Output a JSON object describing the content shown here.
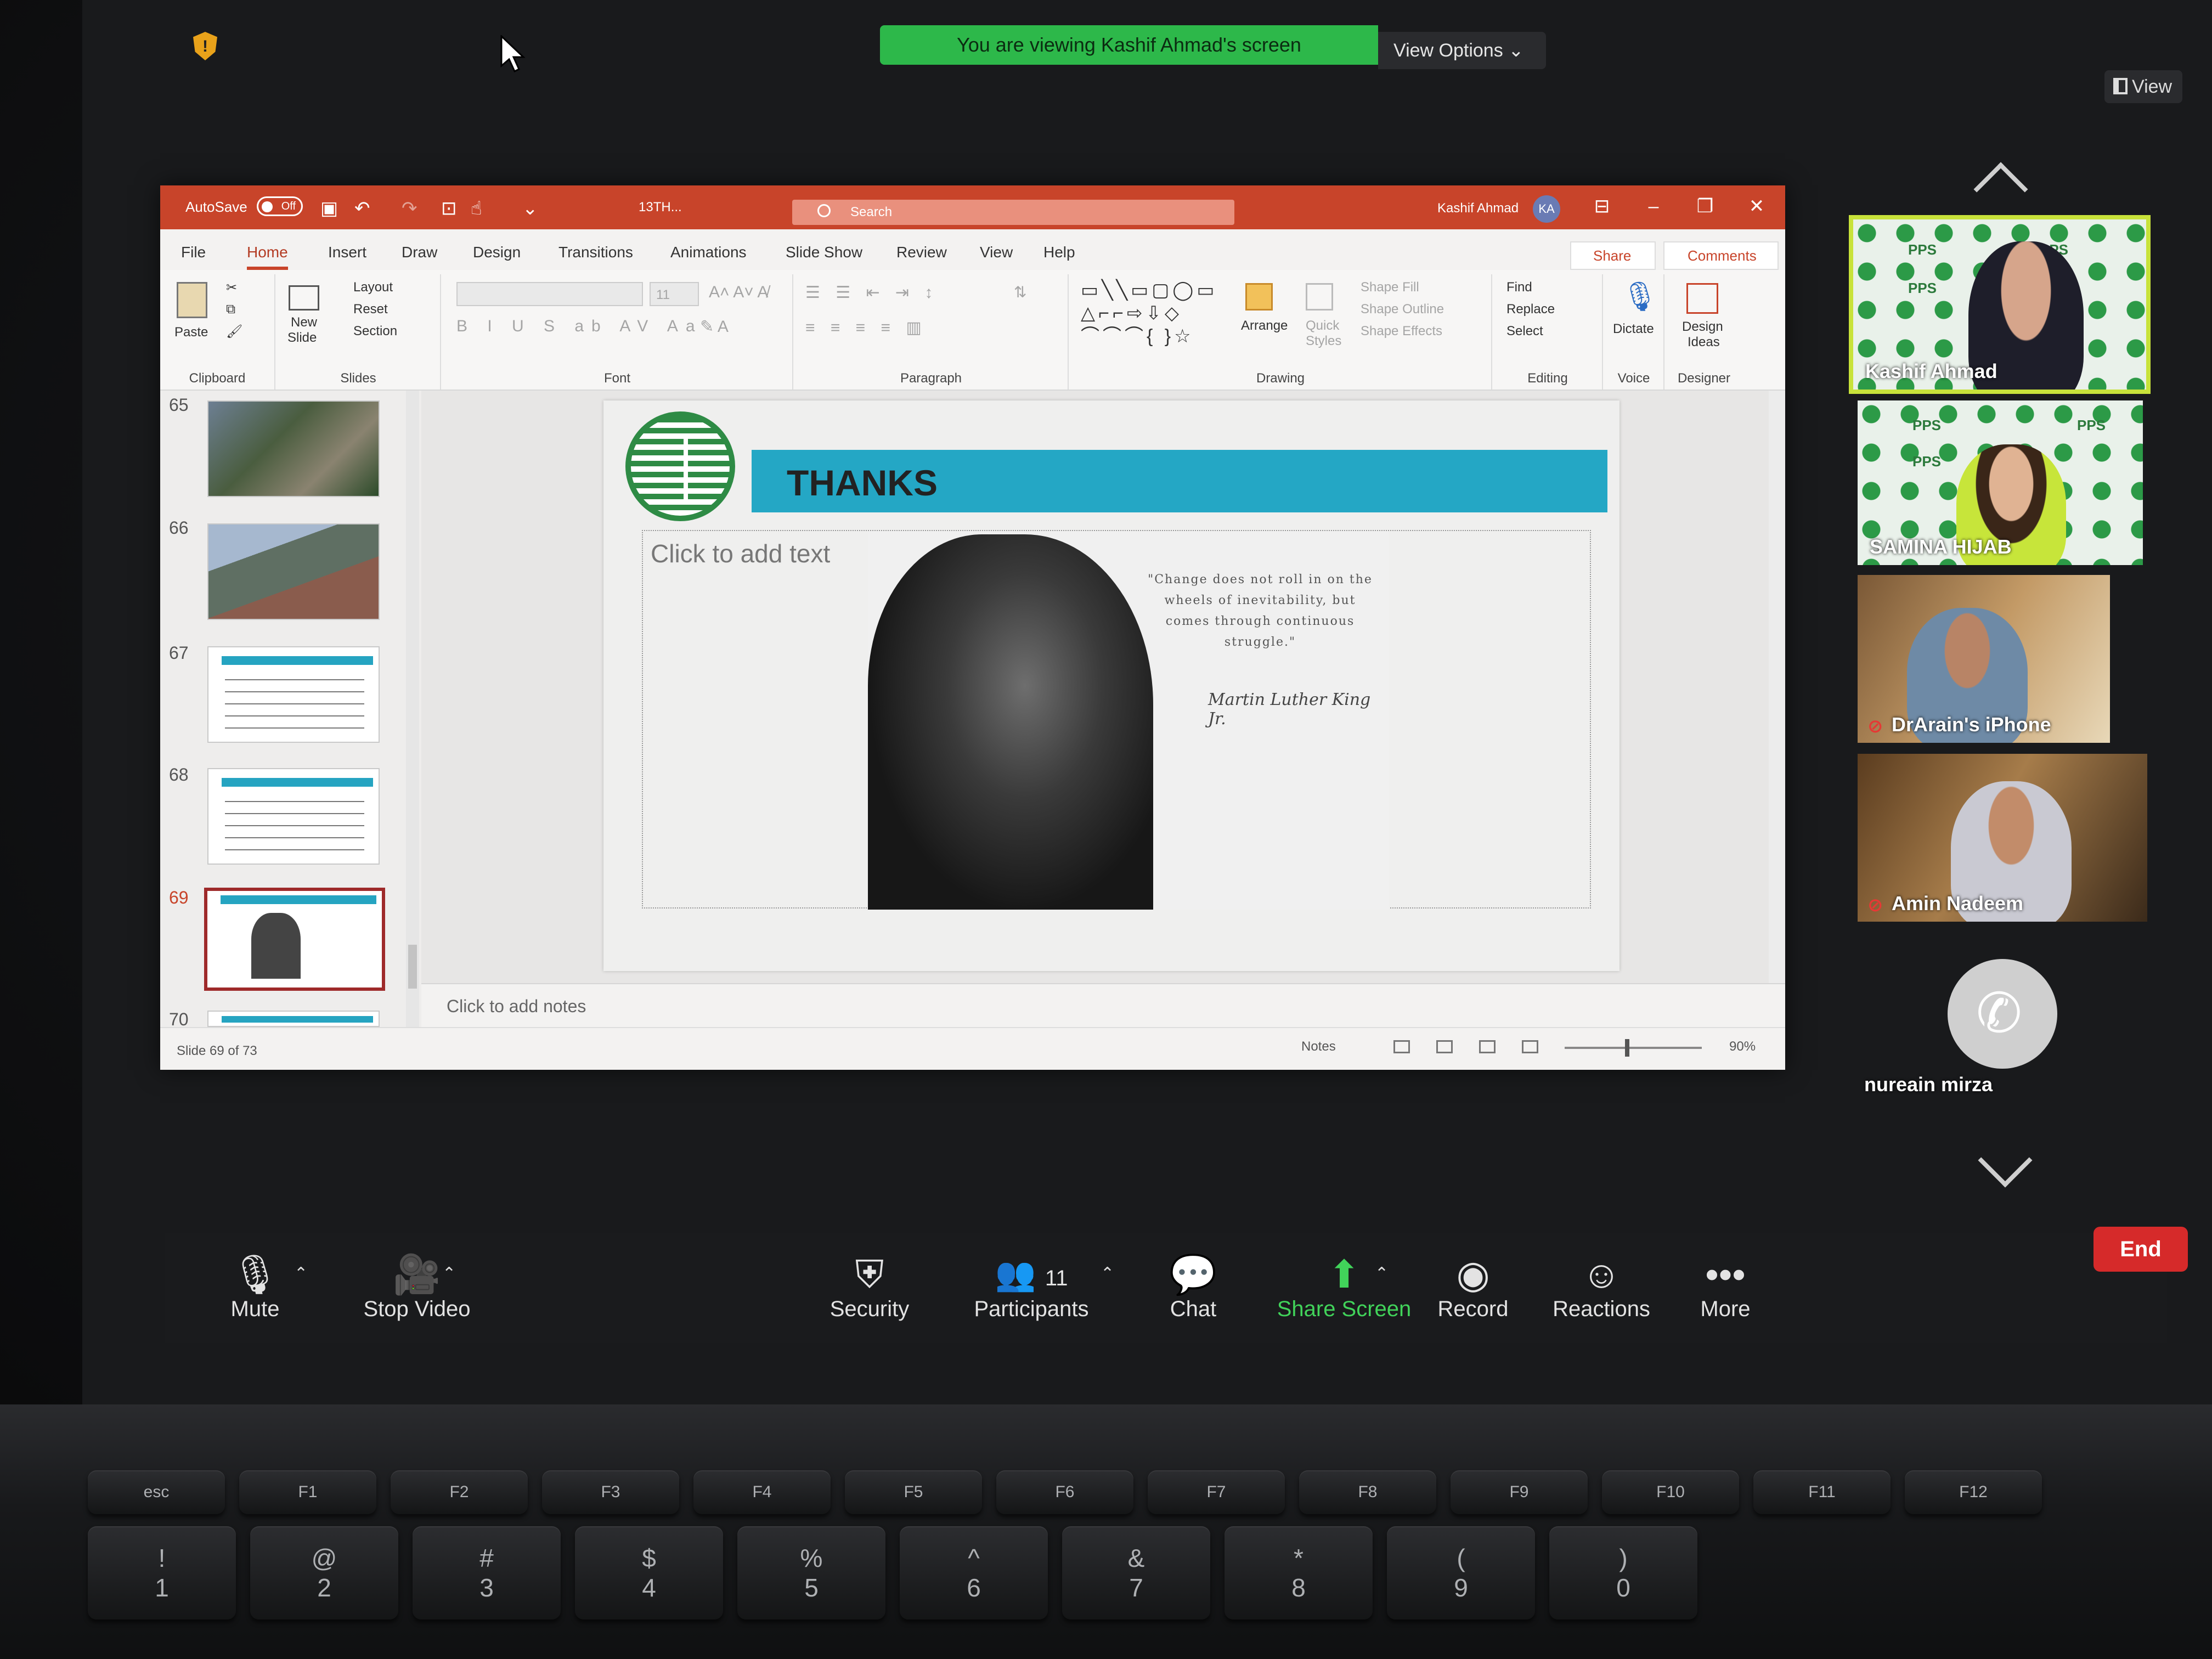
{
  "zoom": {
    "viewing_banner": "You are viewing Kashif Ahmad's screen",
    "view_options": "View Options",
    "view_toggle": "View",
    "end_label": "End",
    "toolbar": {
      "mute": "Mute",
      "stop_video": "Stop Video",
      "security": "Security",
      "participants": "Participants",
      "participants_count": "11",
      "chat": "Chat",
      "share_screen": "Share Screen",
      "record": "Record",
      "reactions": "Reactions",
      "more": "More"
    },
    "participants": [
      {
        "name": "Kashif Ahmad"
      },
      {
        "name": "SAMINA  HIJAB"
      },
      {
        "name": "DrArain's iPhone"
      },
      {
        "name": "Amin Nadeem"
      },
      {
        "name": "nureain mirza"
      }
    ],
    "pps_label": "PPS"
  },
  "ppt": {
    "autosave": "AutoSave",
    "autosave_state": "Off",
    "filename": "13TH...",
    "search_placeholder": "Search",
    "user": "Kashif Ahmad",
    "user_initials": "KA",
    "menu": [
      "File",
      "Home",
      "Insert",
      "Draw",
      "Design",
      "Transitions",
      "Animations",
      "Slide Show",
      "Review",
      "View",
      "Help"
    ],
    "share": "Share",
    "comments": "Comments",
    "ribbon": {
      "clipboard": {
        "label": "Clipboard",
        "paste": "Paste"
      },
      "slides": {
        "label": "Slides",
        "new_slide": "New",
        "new_slide2": "Slide",
        "layout": "Layout",
        "reset": "Reset",
        "section": "Section"
      },
      "font": {
        "label": "Font",
        "size": "11"
      },
      "paragraph": {
        "label": "Paragraph"
      },
      "drawing": {
        "label": "Drawing",
        "arrange": "Arrange",
        "quick": "Quick",
        "styles": "Styles",
        "shape_fill": "Shape Fill",
        "shape_outline": "Shape Outline",
        "shape_effects": "Shape Effects"
      },
      "editing": {
        "label": "Editing",
        "find": "Find",
        "replace": "Replace",
        "select": "Select"
      },
      "voice": {
        "label": "Voice",
        "dictate": "Dictate"
      },
      "designer": {
        "label": "Designer",
        "design": "Design",
        "ideas": "Ideas"
      }
    },
    "thumbnails": [
      {
        "num": "65"
      },
      {
        "num": "66"
      },
      {
        "num": "67"
      },
      {
        "num": "68"
      },
      {
        "num": "69"
      },
      {
        "num": "70"
      }
    ],
    "slide": {
      "title": "THANKS",
      "placeholder": "Click to add text",
      "quote": "\"Change does not roll in on the wheels of inevitability, but comes through continuous struggle.\"",
      "signature": "Martin Luther King Jr."
    },
    "notes_placeholder": "Click to add notes",
    "status": {
      "slide_count": "Slide 69 of 73",
      "notes": "Notes",
      "zoom": "90%"
    }
  },
  "keyboard": {
    "fn_row": [
      "esc",
      "F1",
      "F2",
      "F3",
      "F4",
      "F5",
      "F6",
      "F7",
      "F8",
      "F9",
      "F10",
      "F11",
      "F12"
    ],
    "num_row": [
      "!\n1",
      "@\n2",
      "#\n3",
      "$\n4",
      "%\n5",
      "^\n6",
      "&\n7",
      "*\n8",
      "(\n9",
      ")\n0"
    ]
  },
  "colors": {
    "ppt_accent": "#c8442a",
    "zoom_green": "#2db84a",
    "thanks_bar": "#24a7c5",
    "end_red": "#d62a2a"
  }
}
